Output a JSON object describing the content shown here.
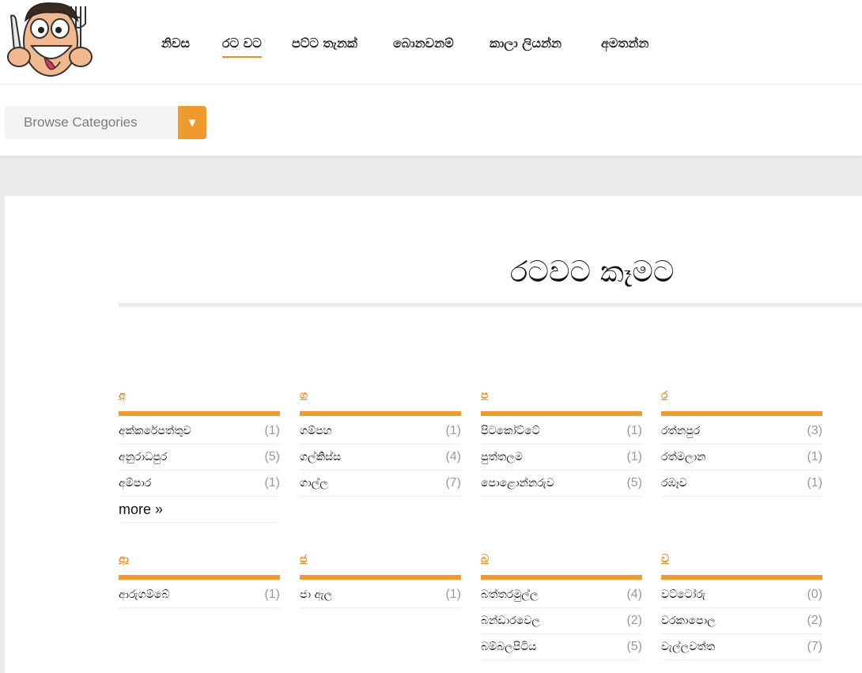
{
  "header": {
    "nav": [
      {
        "label": "නිවස",
        "active": false
      },
      {
        "label": "රට වට",
        "active": true
      },
      {
        "label": "පට්ට තැනක්",
        "active": false
      },
      {
        "label": "බොනවනම්",
        "active": false
      },
      {
        "label": "කාලා ලියන්න",
        "active": false
      },
      {
        "label": "අමතන්න",
        "active": false
      }
    ]
  },
  "browse": {
    "label": "Browse Categories",
    "arrow": "▼"
  },
  "page": {
    "title": "රටවට කෑමට"
  },
  "colors": {
    "accent": "#ef9a2a",
    "link": "#ef8d1f"
  },
  "sections": [
    {
      "letter": "අ",
      "items": [
        {
          "name": "අක්කරේපත්තුව",
          "count": "(1)"
        },
        {
          "name": "අනුරාධපුර",
          "count": "(5)"
        },
        {
          "name": "අම්පාර",
          "count": "(1)"
        }
      ],
      "more": "more »"
    },
    {
      "letter": "ග",
      "items": [
        {
          "name": "ගම්පහ",
          "count": "(1)"
        },
        {
          "name": "ගල්කිස්ස",
          "count": "(4)"
        },
        {
          "name": "ගාල්ල",
          "count": "(7)"
        }
      ]
    },
    {
      "letter": "ප",
      "items": [
        {
          "name": "පිටකෝට්ටේ",
          "count": "(1)"
        },
        {
          "name": "පුත්තලම",
          "count": "(1)"
        },
        {
          "name": "පොළොන්නරුව",
          "count": "(5)"
        }
      ]
    },
    {
      "letter": "ර",
      "items": [
        {
          "name": "රත්නපුර",
          "count": "(3)"
        },
        {
          "name": "රත්මලාන",
          "count": "(1)"
        },
        {
          "name": "රඹෑව",
          "count": "(1)"
        }
      ]
    },
    {
      "letter": "ආ",
      "items": [
        {
          "name": "ආරුගම්බේ",
          "count": "(1)"
        }
      ]
    },
    {
      "letter": "ජ",
      "items": [
        {
          "name": "ජා ඇල",
          "count": "(1)"
        }
      ]
    },
    {
      "letter": "බ",
      "items": [
        {
          "name": "බත්තරමුල්ල",
          "count": "(4)"
        },
        {
          "name": "බන්ඩාරවෙල",
          "count": "(2)"
        },
        {
          "name": "බම්බලපිටිය",
          "count": "(5)"
        }
      ]
    },
    {
      "letter": "ව",
      "items": [
        {
          "name": "වට්ටෝරු",
          "count": "(0)"
        },
        {
          "name": "වරකාපොල",
          "count": "(2)"
        },
        {
          "name": "වැල්ලවත්ත",
          "count": "(7)"
        }
      ]
    }
  ]
}
